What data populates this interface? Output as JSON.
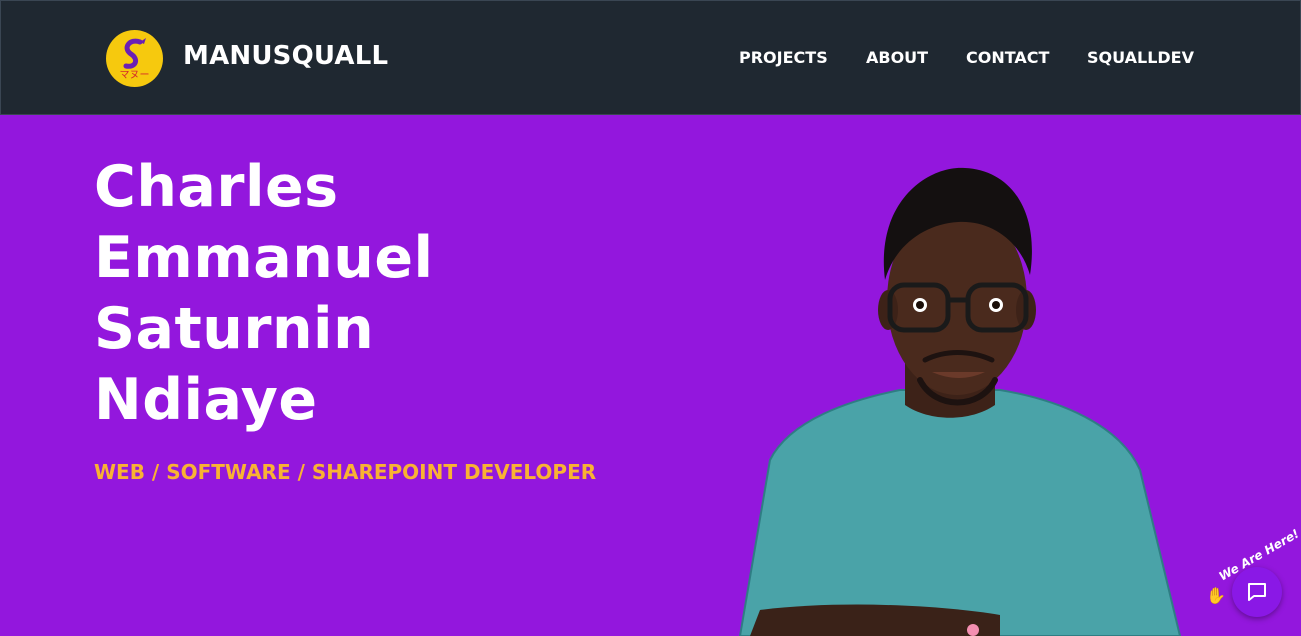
{
  "header": {
    "brand": "MANUSQUALL",
    "logo_icon": "s-dragon-logo-icon",
    "logo_text": "マヌー",
    "nav": [
      {
        "label": "PROJECTS"
      },
      {
        "label": "ABOUT"
      },
      {
        "label": "CONTACT"
      },
      {
        "label": "SQUALLDEV"
      }
    ]
  },
  "hero": {
    "name_lines": [
      "Charles",
      "Emmanuel",
      "Saturnin",
      "Ndiaye"
    ],
    "role": "WEB / SOFTWARE / SHAREPOINT DEVELOPER",
    "portrait_icon": "developer-portrait-illustration"
  },
  "chat": {
    "label": "We Are Here!",
    "icon": "chat-bubble-icon",
    "wave_icon": "waving-hand-icon"
  },
  "colors": {
    "header_bg": "#1f2831",
    "hero_bg": "#9317dd",
    "accent": "#f9b233",
    "logo_bg": "#f6c90e",
    "chat_bg": "#8a18e6"
  }
}
